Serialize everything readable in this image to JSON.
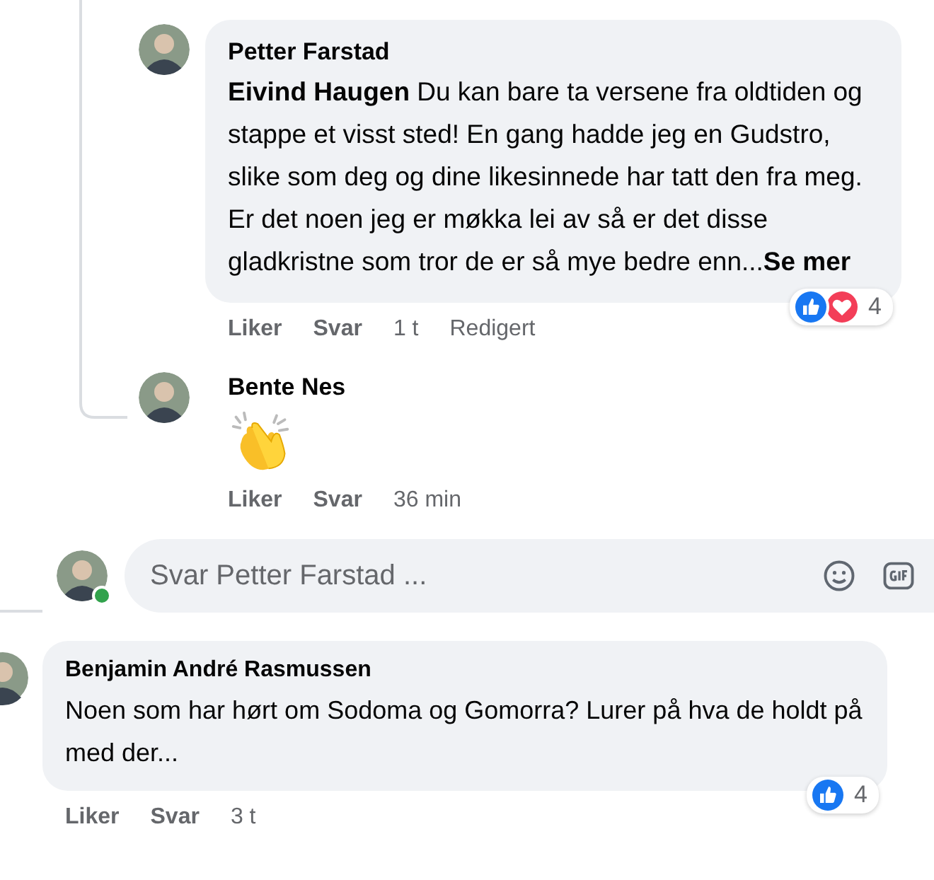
{
  "comments": [
    {
      "kind": "text",
      "author": "Petter Farstad",
      "mention": "Eivind Haugen",
      "body": " Du kan bare ta versene fra oldtiden og stappe et visst sted! En gang hadde jeg en Gudstro, slike som deg og dine likesinnede har tatt den fra meg. Er det noen jeg er møkka lei av så er det disse gladkristne som tror de er så mye bedre enn...",
      "see_more": "Se mer",
      "actions": [
        "Liker",
        "Svar"
      ],
      "time": "1 t",
      "edited": "Redigert",
      "reactions": {
        "icons": [
          {
            "kind": "like"
          },
          {
            "kind": "love"
          }
        ],
        "count": "4"
      }
    },
    {
      "kind": "emoji",
      "author": "Bente Nes",
      "actions": [
        "Liker",
        "Svar"
      ],
      "time": "36 min"
    }
  ],
  "reply_field": {
    "placeholder": "Svar Petter Farstad ...",
    "online": true
  },
  "top_comment": {
    "author": "Benjamin André Rasmussen",
    "body": "Noen som har hørt om Sodoma og Gomorra? Lurer på hva de holdt på med der...",
    "actions": [
      "Liker",
      "Svar"
    ],
    "time": "3 t",
    "reactions": {
      "icons": [
        {
          "kind": "like"
        }
      ],
      "count": "4"
    }
  }
}
